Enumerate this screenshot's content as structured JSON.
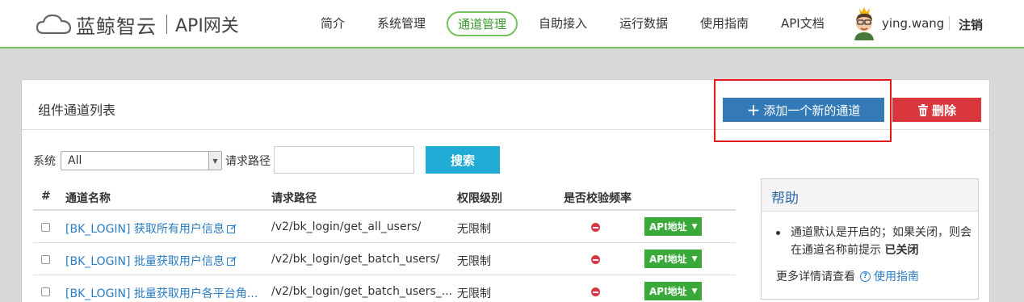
{
  "header": {
    "logo_text": "蓝鲸智云",
    "logo_sub": "API网关",
    "nav": [
      "简介",
      "系统管理",
      "通道管理",
      "自助接入",
      "运行数据",
      "使用指南",
      "API文档"
    ],
    "active_nav": "通道管理",
    "username": "ying.wang",
    "logout": "注销"
  },
  "panel": {
    "title": "组件通道列表",
    "add_button": "添加一个新的通道",
    "delete_button": "删除"
  },
  "filters": {
    "system_label": "系统",
    "system_value": "All",
    "path_label": "请求路径",
    "path_value": "",
    "search_button": "搜索"
  },
  "table": {
    "headers": [
      "#",
      "通道名称",
      "请求路径",
      "权限级别",
      "是否校验频率"
    ],
    "rows": [
      {
        "name": "[BK_LOGIN] 获取所有用户信息",
        "path": "/v2/bk_login/get_all_users/",
        "perm": "无限制",
        "api": "API地址"
      },
      {
        "name": "[BK_LOGIN] 批量获取用户信息",
        "path": "/v2/bk_login/get_batch_users/",
        "perm": "无限制",
        "api": "API地址"
      },
      {
        "name": "[BK_LOGIN] 批量获取用户各平台角...",
        "path": "/v2/bk_login/get_batch_users_...",
        "perm": "无限制",
        "api": "API地址"
      }
    ]
  },
  "help": {
    "title": "帮助",
    "item_text": "通道默认是开启的；如果关闭，则会在通道名称前提示",
    "item_bold": "已关闭",
    "more_text": "更多详情请查看",
    "more_link": "使用指南"
  },
  "colors": {
    "nav_accent": "#74c15d",
    "add_button": "#337ab7",
    "delete_button": "#d9363e",
    "search_button": "#20acd4",
    "api_button": "#3aa93a",
    "link": "#2b7cc2",
    "highlight_box": "#e31818"
  }
}
